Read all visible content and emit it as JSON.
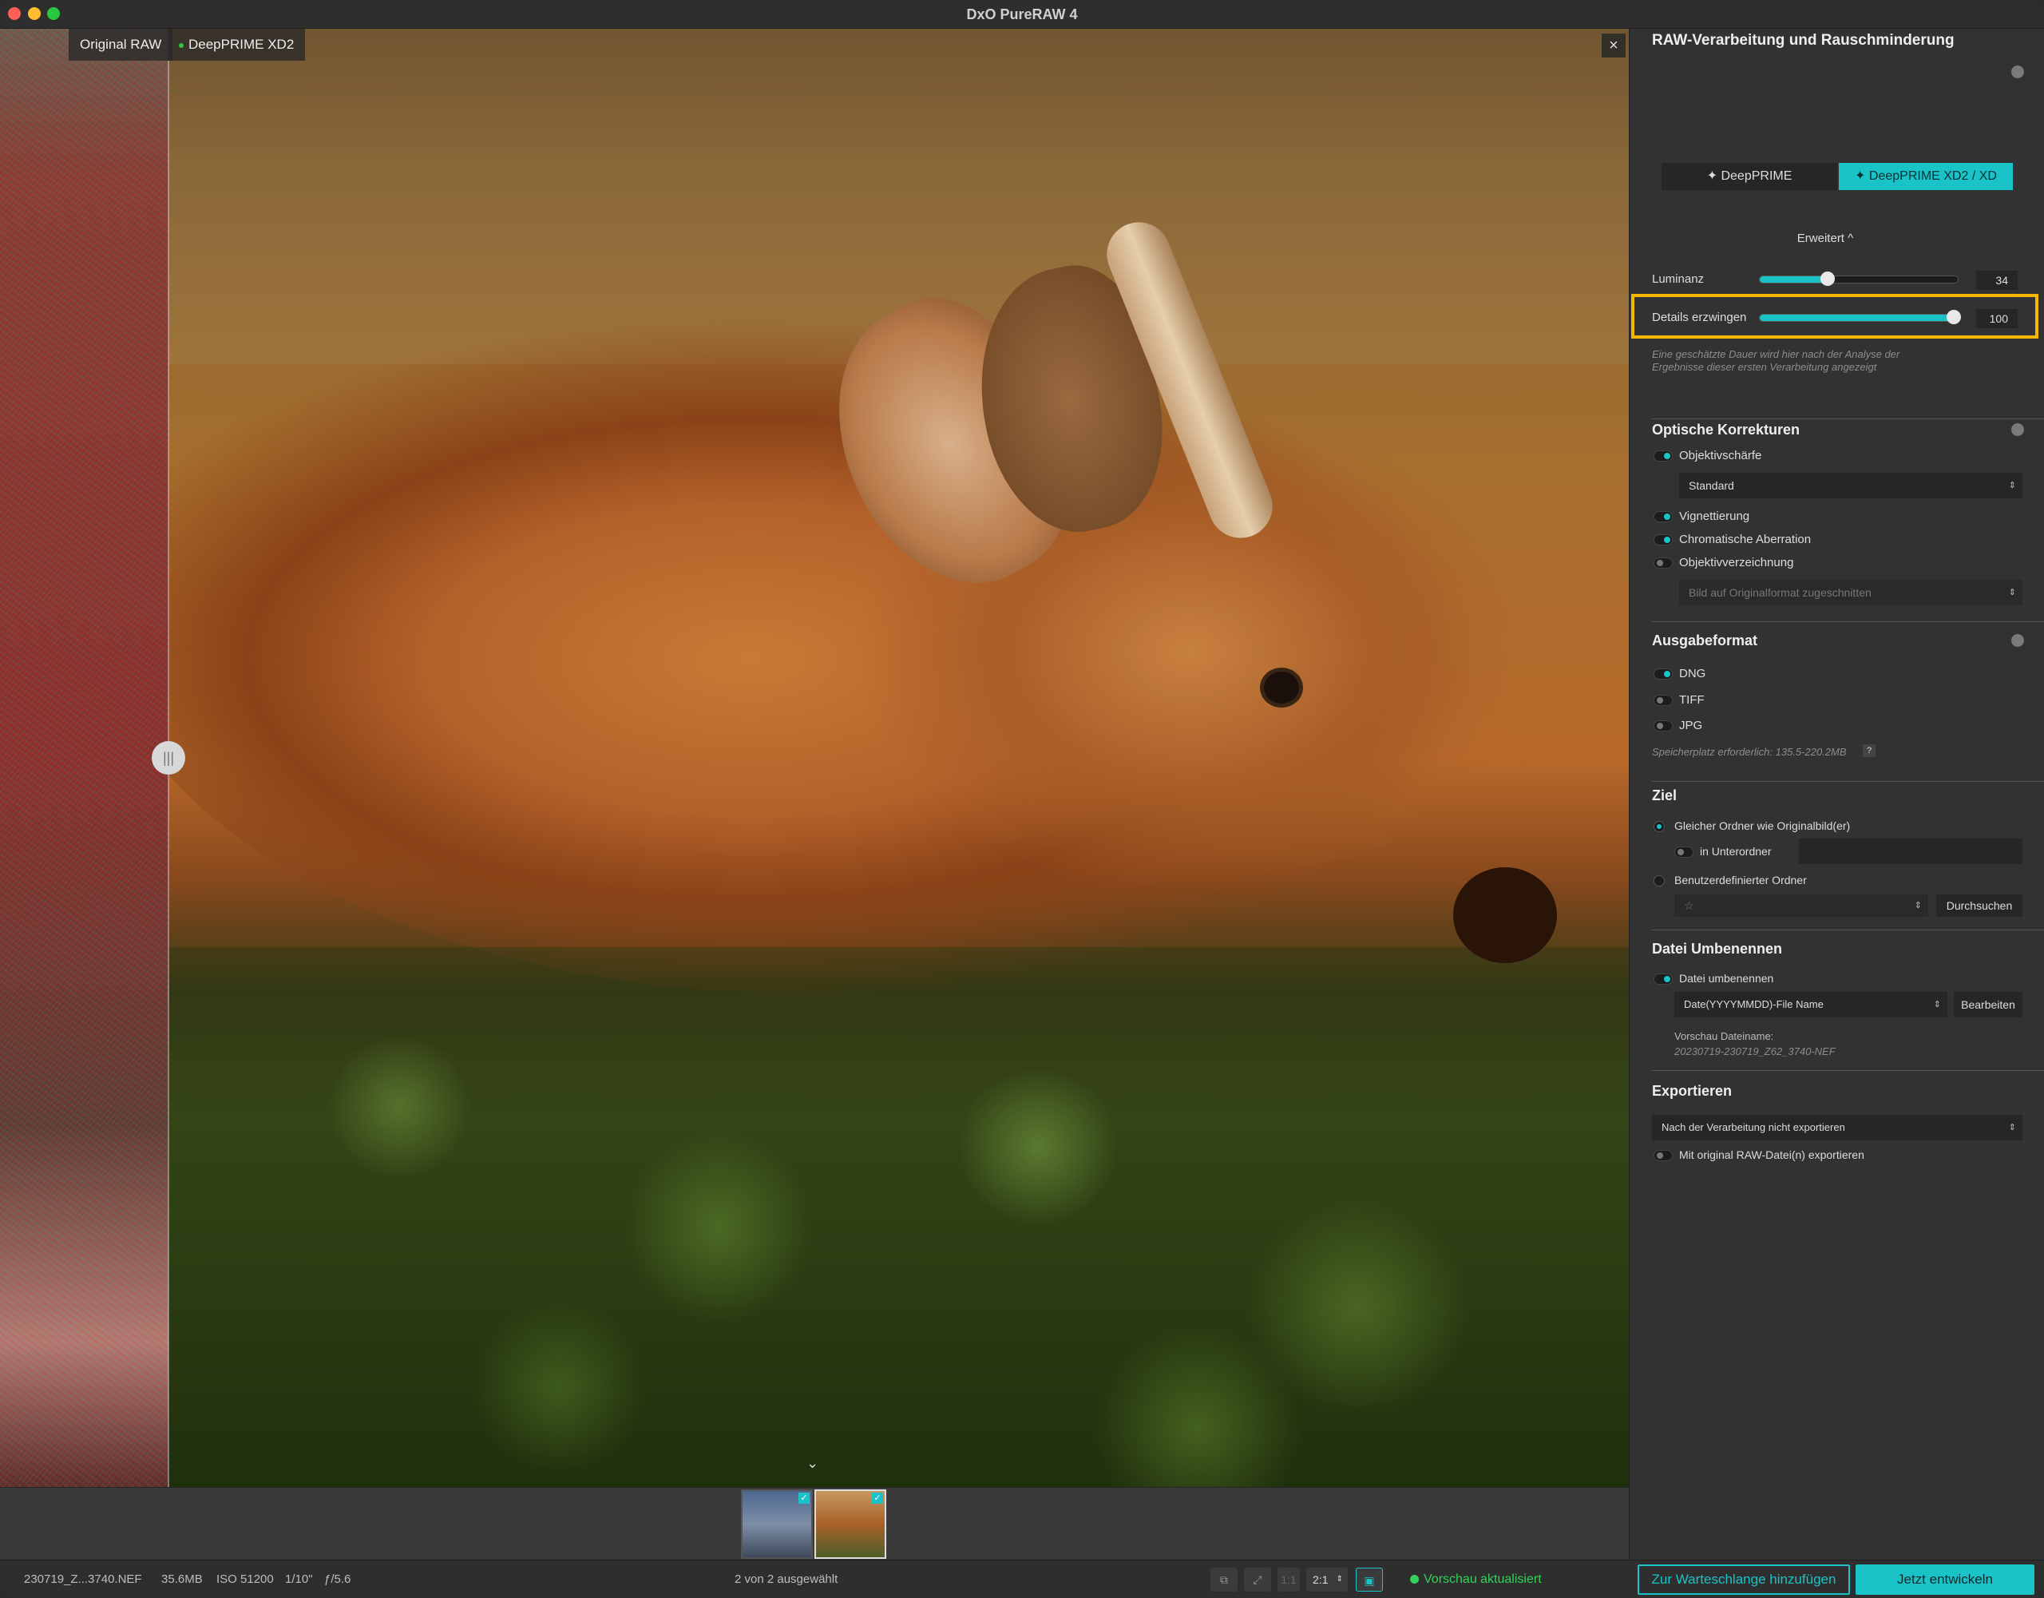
{
  "window": {
    "title": "DxO PureRAW 4"
  },
  "viewer": {
    "tag_original": "Original RAW",
    "tag_processed": "DeepPRIME XD2",
    "close_label": "×",
    "split_handle_label": "|||",
    "expand_label": "⌄"
  },
  "filmstrip": {
    "thumbnails": [
      {
        "checked": true
      },
      {
        "checked": true
      }
    ],
    "check_glyph": "✓"
  },
  "status": {
    "file": "230719_Z...3740.NEF",
    "size": "35.6MB",
    "iso": "ISO 51200",
    "exposure": "1/10\"",
    "aperture": "ƒ/5.6",
    "selection": "2 von 2 ausgewählt",
    "zoom": "2:1",
    "zoom_1to1": "1:1",
    "preview_status": "Vorschau aktualisiert",
    "queue_button": "Zur Warteschlange hinzufügen",
    "develop_button": "Jetzt entwickeln",
    "colors": {
      "accent": "#19c3c7",
      "ok": "#33d15a"
    }
  },
  "panel": {
    "denoise": {
      "title": "RAW-Verarbeitung und Rauschminderung",
      "mode_deepprime": "DeepPRIME",
      "mode_xd": "DeepPRIME XD2 / XD",
      "advanced_label": "Erweitert ^",
      "luminance_label": "Luminanz",
      "luminance_value": "34",
      "details_label": "Details erzwingen",
      "details_value": "100",
      "note": "Eine geschätzte Dauer wird hier nach der Analyse der Ergebnisse dieser ersten Verarbeitung angezeigt"
    },
    "optics": {
      "title": "Optische Korrekturen",
      "sharpness_label": "Objektivschärfe",
      "sharpness_option": "Standard",
      "vignetting_label": "Vignettierung",
      "chromatic_label": "Chromatische Aberration",
      "distortion_label": "Objektivverzeichnung",
      "distortion_option": "Bild auf Originalformat zugeschnitten"
    },
    "output": {
      "title": "Ausgabeformat",
      "dng": "DNG",
      "tiff": "TIFF",
      "jpg": "JPG",
      "storage": "Speicherplatz erforderlich: 135.5-220.2MB",
      "help": "?"
    },
    "destination": {
      "title": "Ziel",
      "same_folder": "Gleicher Ordner wie Originalbild(er)",
      "subfolder": "in Unterordner",
      "custom_folder": "Benutzerdefinierter Ordner",
      "star": "☆",
      "browse": "Durchsuchen"
    },
    "rename": {
      "title": "Datei Umbenennen",
      "rename_label": "Datei umbenennen",
      "pattern": "Date(YYYYMMDD)-File Name",
      "edit": "Bearbeiten",
      "preview_label": "Vorschau Dateiname:",
      "preview_value": "20230719-230719_Z62_3740-NEF"
    },
    "export": {
      "title": "Exportieren",
      "option": "Nach der Verarbeitung nicht exportieren",
      "with_raw": "Mit original RAW-Datei(n) exportieren"
    }
  }
}
